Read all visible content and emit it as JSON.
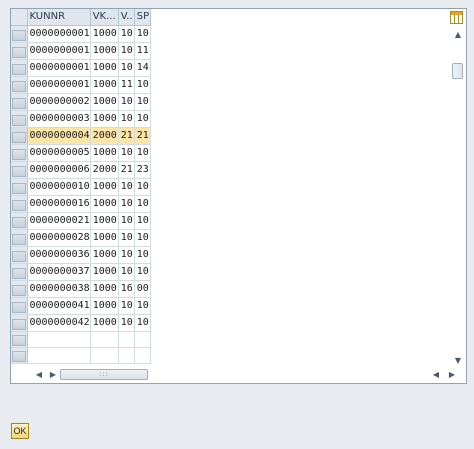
{
  "table": {
    "columns": [
      "KUNNR",
      "VK...",
      "V..",
      "SP"
    ],
    "rows": [
      [
        "0000000001",
        "1000",
        "10",
        "10"
      ],
      [
        "0000000001",
        "1000",
        "10",
        "11"
      ],
      [
        "0000000001",
        "1000",
        "10",
        "14"
      ],
      [
        "0000000001",
        "1000",
        "11",
        "10"
      ],
      [
        "0000000002",
        "1000",
        "10",
        "10"
      ],
      [
        "0000000003",
        "1000",
        "10",
        "10"
      ],
      [
        "0000000004",
        "2000",
        "21",
        "21"
      ],
      [
        "0000000005",
        "1000",
        "10",
        "10"
      ],
      [
        "0000000006",
        "2000",
        "21",
        "23"
      ],
      [
        "0000000010",
        "1000",
        "10",
        "10"
      ],
      [
        "0000000016",
        "1000",
        "10",
        "10"
      ],
      [
        "0000000021",
        "1000",
        "10",
        "10"
      ],
      [
        "0000000028",
        "1000",
        "10",
        "10"
      ],
      [
        "0000000036",
        "1000",
        "10",
        "10"
      ],
      [
        "0000000037",
        "1000",
        "10",
        "10"
      ],
      [
        "0000000038",
        "1000",
        "16",
        "00"
      ],
      [
        "0000000041",
        "1000",
        "10",
        "10"
      ],
      [
        "0000000042",
        "1000",
        "10",
        "10"
      ]
    ],
    "highlighted_row": 6
  },
  "hscroll": {
    "grip": ":::"
  },
  "footer": {
    "ok_label": "OK"
  },
  "colors": {
    "highlight": "#fbe6a8",
    "ok_button": "#f2d77c"
  }
}
